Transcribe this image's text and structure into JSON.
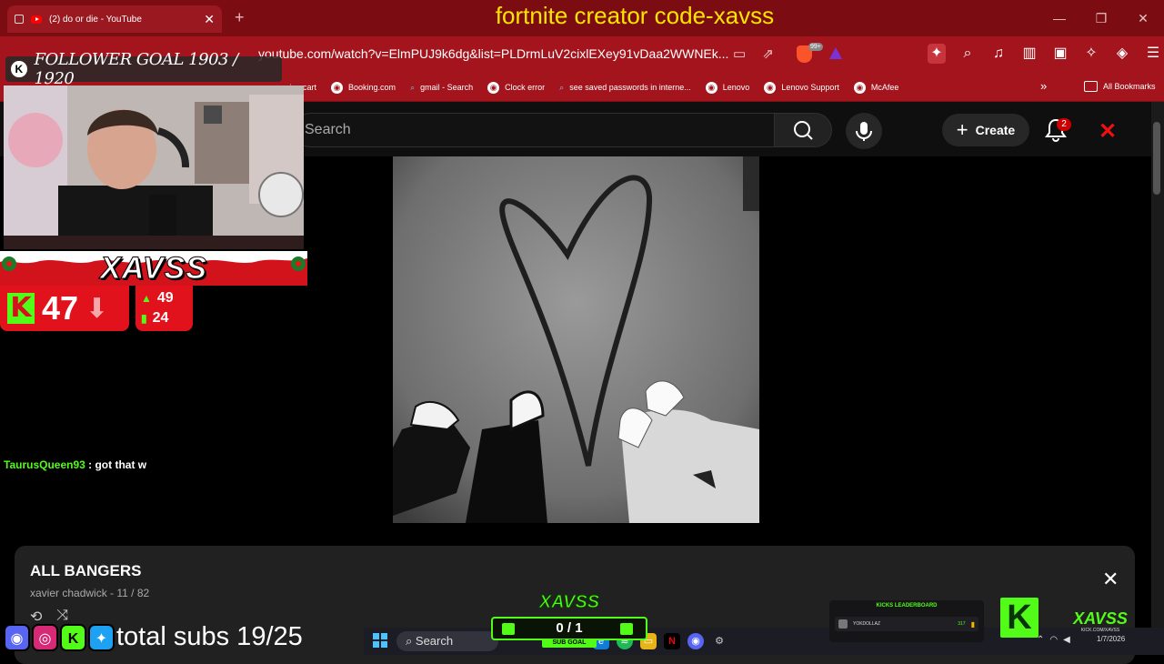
{
  "browser": {
    "tab_title": "(2) do or die - YouTube",
    "tab_close": "✕",
    "new_tab": "+",
    "url": "youtube.com/watch?v=ElmPUJ9k6dg&list=PLDrmLuV2cixlEXey91vDaa2WWNEk...",
    "badge": "99+",
    "window_controls": [
      "—",
      "❐",
      "✕"
    ],
    "bookmarks": [
      {
        "label": "...ping cart",
        "icon": "globe-icon"
      },
      {
        "label": "Booking.com",
        "icon": "globe-icon"
      },
      {
        "label": "gmail - Search",
        "icon": "search-icon"
      },
      {
        "label": "Clock error",
        "icon": "globe-icon"
      },
      {
        "label": "see saved passwords in interne...",
        "icon": "search-icon"
      },
      {
        "label": "Lenovo",
        "icon": "globe-icon"
      },
      {
        "label": "Lenovo Support",
        "icon": "globe-icon"
      },
      {
        "label": "McAfee",
        "icon": "globe-icon"
      }
    ],
    "bookmarks_more": "»",
    "all_bookmarks": "All Bookmarks"
  },
  "overlay_title": "fortnite creator code-xavss",
  "youtube": {
    "search_placeholder": "Search",
    "create_label": "Create",
    "notification_count": "2"
  },
  "playlist": {
    "title": "ALL BANGERS",
    "subtitle": "xavier chadwick - 11 / 82",
    "close": "✕"
  },
  "stream": {
    "follower_goal": "FOLLOWER GOAL 1903 / 1920",
    "streamer_name": "XAVSS",
    "viewers": "47",
    "stat_a": "49",
    "stat_b": "24",
    "chat": {
      "user": "TaurusQueen93",
      "message": " : got that w"
    },
    "total_subs": "total subs 19/25",
    "sub_goal_brand": "XAVSS",
    "sub_goal_value": "0 / 1",
    "sub_goal_label": "SUB GOAL",
    "leaderboard_title": "KICKS LEADERBOARD",
    "leaderboard_user": "YOKDOLLAZ",
    "leaderboard_amount": "317",
    "brand_name": "XAVSS",
    "brand_url": "KICK.COM/XAVSS"
  },
  "taskbar": {
    "search": "Search",
    "date": "1/7/2026"
  },
  "colors": {
    "browser_red": "#a3141c",
    "title_red": "#7b0d12",
    "kick_green": "#53fc18",
    "overlay_yellow": "#ffe600"
  }
}
